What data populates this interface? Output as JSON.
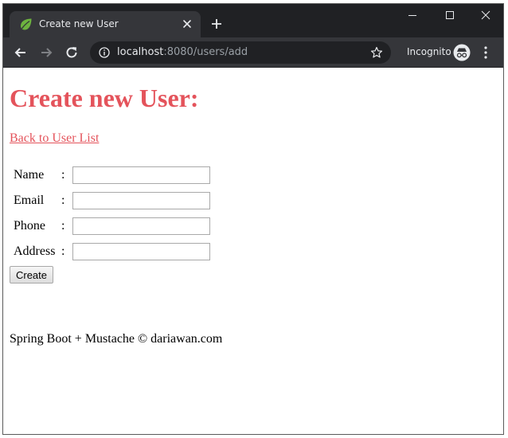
{
  "browser": {
    "tab_title": "Create new User",
    "url_host": "localhost",
    "url_rest": ":8080/users/add",
    "incognito_label": "Incognito",
    "icons": {
      "favicon": "spring-leaf-icon",
      "tab_close": "close-icon",
      "new_tab": "plus-icon",
      "back": "arrow-left-icon",
      "forward": "arrow-right-icon",
      "reload": "reload-icon",
      "info": "info-icon",
      "bookmark": "star-icon",
      "incognito": "incognito-icon",
      "menu": "kebab-menu-icon"
    },
    "colors": {
      "titlebar": "#202124",
      "toolbar": "#35363a",
      "omnibox": "#202124"
    }
  },
  "page": {
    "title": "Create new User:",
    "back_link": "Back to User List",
    "accent_color": "#e4535b",
    "form": {
      "fields": [
        {
          "label": "Name",
          "colon": ":",
          "value": ""
        },
        {
          "label": "Email",
          "colon": ":",
          "value": ""
        },
        {
          "label": "Phone",
          "colon": ":",
          "value": ""
        },
        {
          "label": "Address",
          "colon": ":",
          "value": ""
        }
      ],
      "submit_label": "Create"
    },
    "footer": "Spring Boot + Mustache © dariawan.com"
  }
}
